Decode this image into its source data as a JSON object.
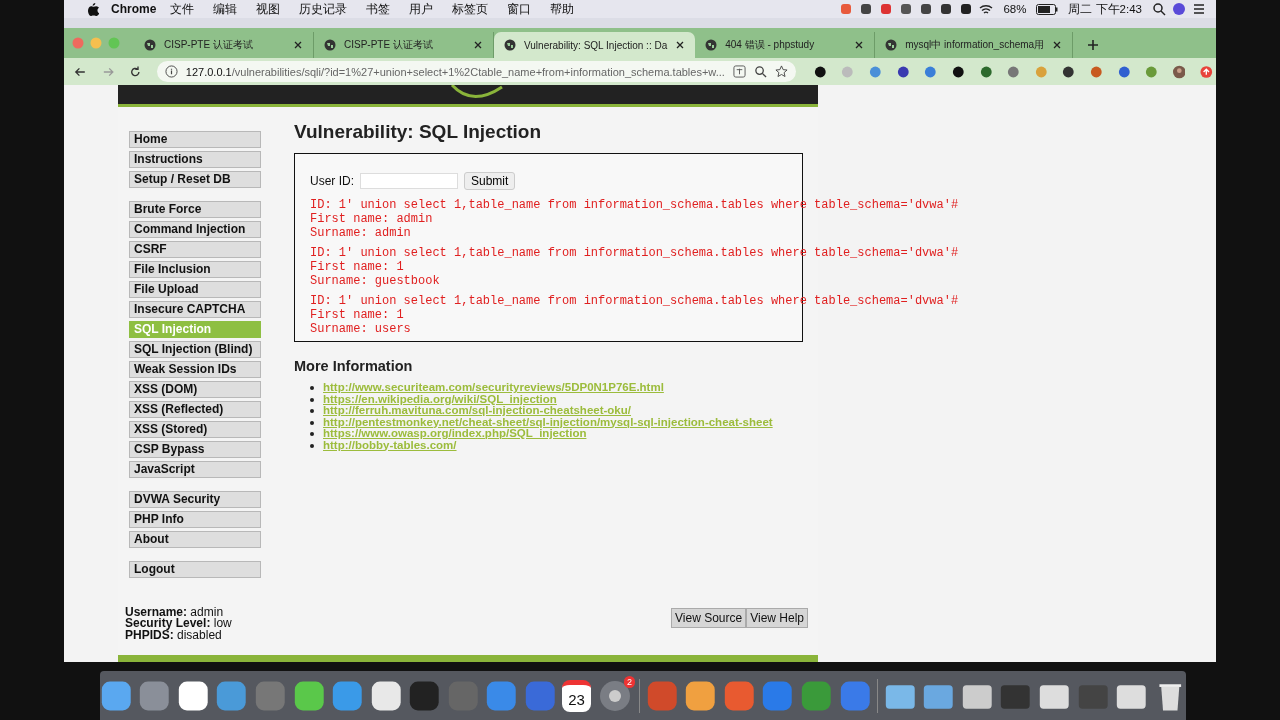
{
  "menu_bar": {
    "app": "Chrome",
    "items": [
      "文件",
      "编辑",
      "视图",
      "历史记录",
      "书签",
      "用户",
      "标签页",
      "窗口",
      "帮助"
    ],
    "battery": "68%",
    "clock": "周二 下午2:43"
  },
  "tabs": [
    {
      "title": "CISP-PTE 认证考试",
      "selected": false
    },
    {
      "title": "CISP-PTE 认证考试",
      "selected": false
    },
    {
      "title": "Vulnerability: SQL Injection :: Da",
      "selected": true
    },
    {
      "title": "404 错误 - phpstudy",
      "selected": false
    },
    {
      "title": "mysql中 information_schema用",
      "selected": false
    }
  ],
  "address": {
    "host": "127.0.0.1",
    "path": "/vulnerabilities/sqli/?id=1%27+union+select+1%2Ctable_name+from+information_schema.tables+w..."
  },
  "sidebar": {
    "groups": [
      [
        {
          "label": "Home",
          "selected": false
        },
        {
          "label": "Instructions",
          "selected": false
        },
        {
          "label": "Setup / Reset DB",
          "selected": false
        }
      ],
      [
        {
          "label": "Brute Force",
          "selected": false
        },
        {
          "label": "Command Injection",
          "selected": false
        },
        {
          "label": "CSRF",
          "selected": false
        },
        {
          "label": "File Inclusion",
          "selected": false
        },
        {
          "label": "File Upload",
          "selected": false
        },
        {
          "label": "Insecure CAPTCHA",
          "selected": false
        },
        {
          "label": "SQL Injection",
          "selected": true
        },
        {
          "label": "SQL Injection (Blind)",
          "selected": false
        },
        {
          "label": "Weak Session IDs",
          "selected": false
        },
        {
          "label": "XSS (DOM)",
          "selected": false
        },
        {
          "label": "XSS (Reflected)",
          "selected": false
        },
        {
          "label": "XSS (Stored)",
          "selected": false
        },
        {
          "label": "CSP Bypass",
          "selected": false
        },
        {
          "label": "JavaScript",
          "selected": false
        }
      ],
      [
        {
          "label": "DVWA Security",
          "selected": false
        },
        {
          "label": "PHP Info",
          "selected": false
        },
        {
          "label": "About",
          "selected": false
        }
      ],
      [
        {
          "label": "Logout",
          "selected": false
        }
      ]
    ]
  },
  "main": {
    "title": "Vulnerability: SQL Injection",
    "form": {
      "label": "User ID:",
      "button": "Submit"
    },
    "results": [
      [
        "ID: 1' union select 1,table_name from information_schema.tables where table_schema='dvwa'#",
        "First name: admin",
        "Surname: admin"
      ],
      [
        "ID: 1' union select 1,table_name from information_schema.tables where table_schema='dvwa'#",
        "First name: 1",
        "Surname: guestbook"
      ],
      [
        "ID: 1' union select 1,table_name from information_schema.tables where table_schema='dvwa'#",
        "First name: 1",
        "Surname: users"
      ]
    ],
    "more_title": "More Information",
    "links": [
      "http://www.securiteam.com/securityreviews/5DP0N1P76E.html",
      "https://en.wikipedia.org/wiki/SQL_injection",
      "http://ferruh.mavituna.com/sql-injection-cheatsheet-oku/",
      "http://pentestmonkey.net/cheat-sheet/sql-injection/mysql-sql-injection-cheat-sheet",
      "https://www.owasp.org/index.php/SQL_injection",
      "http://bobby-tables.com/"
    ]
  },
  "footer": {
    "info": [
      "**Username:** admin",
      "**Security Level:** low",
      "**PHPIDS:** disabled"
    ],
    "buttons": [
      "View Source",
      "View Help"
    ]
  },
  "dock": {
    "calendar_date": "23",
    "settings_badge": "2"
  }
}
